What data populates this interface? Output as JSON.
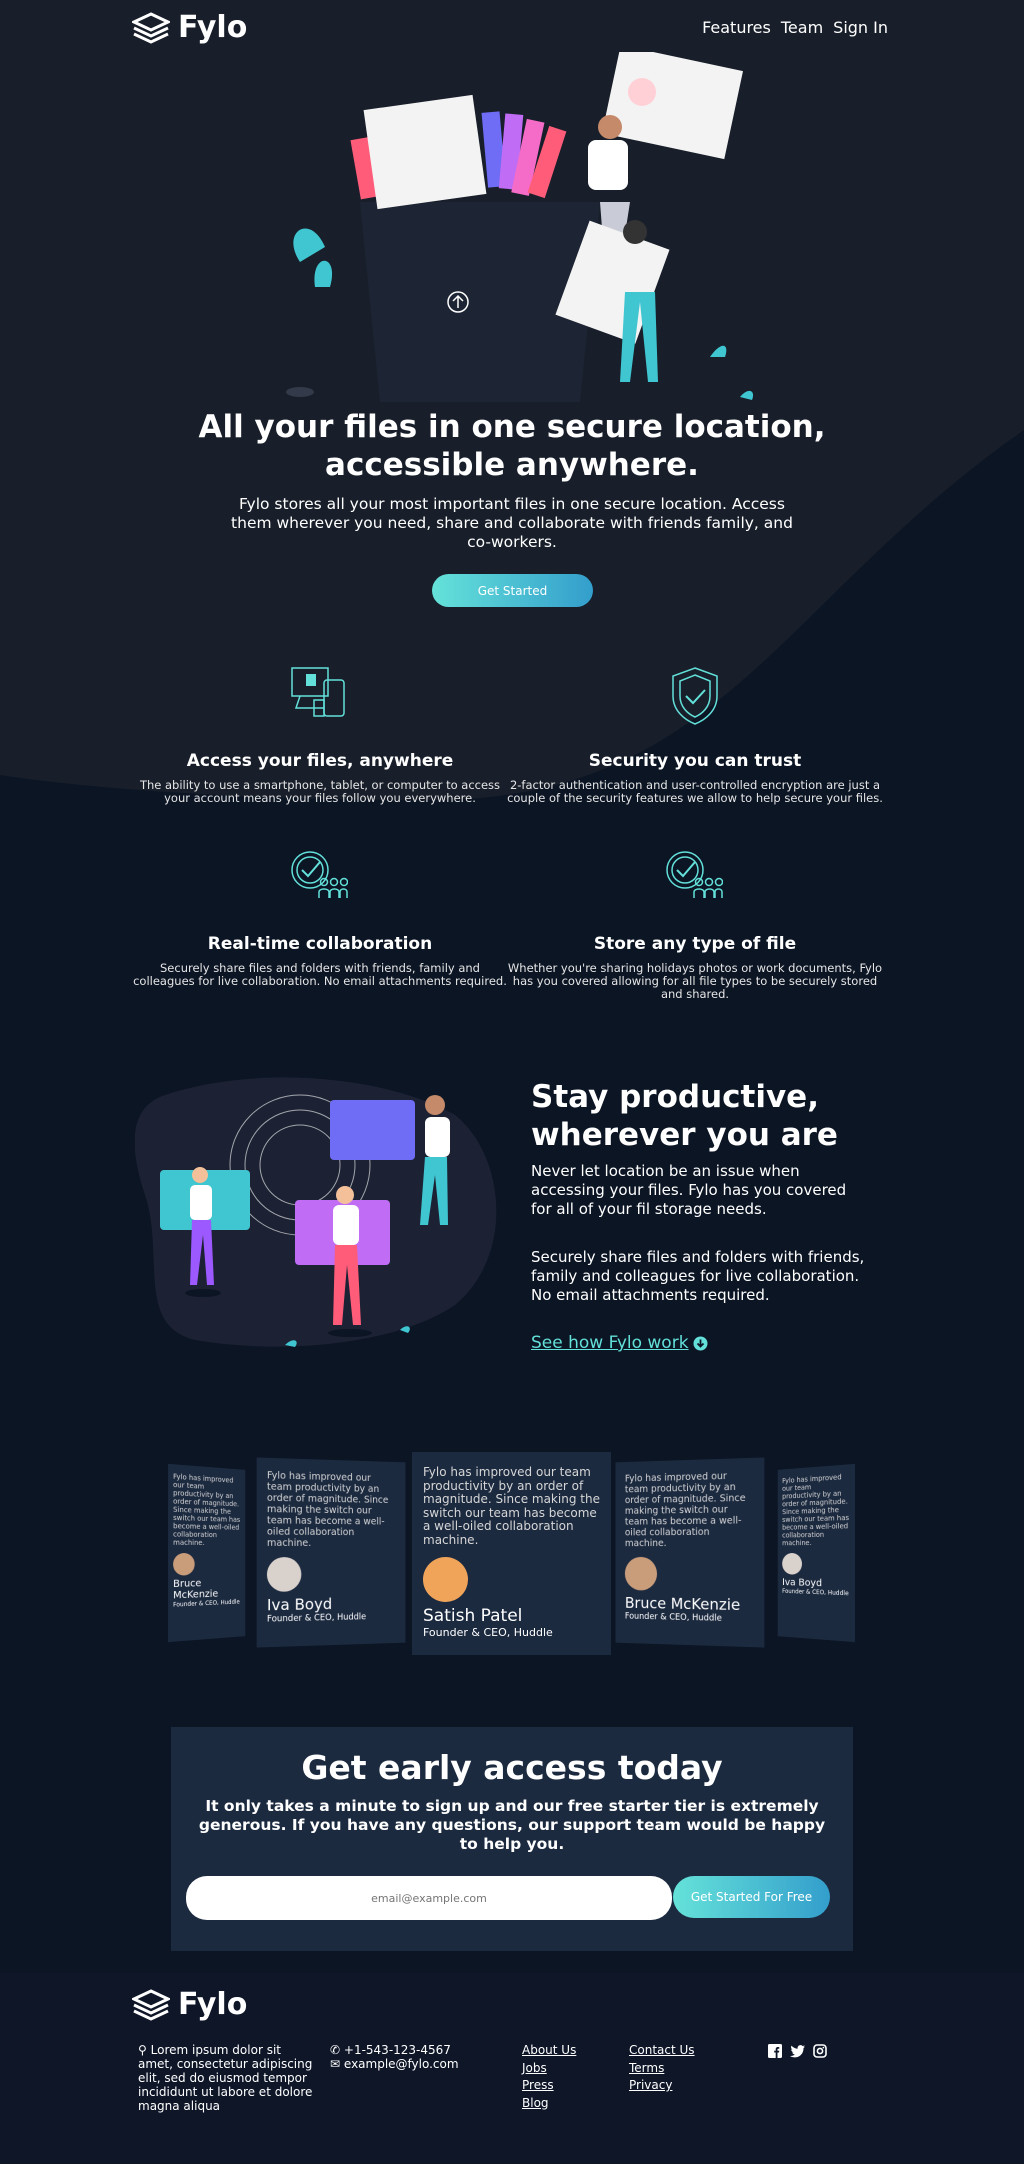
{
  "header": {
    "logo_text": "Fylo",
    "nav": [
      "Features",
      "Team",
      "Sign In"
    ]
  },
  "hero": {
    "title": "All your files in one secure location, accessible anywhere.",
    "text": "Fylo stores all your most important files in one secure location. Access them wherever you need, share and collaborate with friends family, and co-workers.",
    "cta": "Get Started"
  },
  "features": [
    {
      "icon": "devices-icon",
      "title": "Access your files, anywhere",
      "text": "The ability to use a smartphone, tablet, or computer to access your account means your files follow you everywhere."
    },
    {
      "icon": "shield-check-icon",
      "title": "Security you can trust",
      "text": "2-factor authentication and user-controlled encryption are just a couple of the security features we allow to help secure your files."
    },
    {
      "icon": "collaboration-icon",
      "title": "Real-time collaboration",
      "text": "Securely share files and folders with friends, family and colleagues for live collaboration. No email attachments required."
    },
    {
      "icon": "collaboration-icon",
      "title": "Store any type of file",
      "text": "Whether you're sharing holidays photos or work documents, Fylo has you covered allowing for all file types to be securely stored and shared."
    }
  ],
  "productive": {
    "title": "Stay productive, wherever you are",
    "p1": "Never let location be an issue when accessing your files. Fylo has you covered for all of your fil storage needs.",
    "p2": "Securely share files and folders with friends, family and colleagues for live collaboration. No email attachments required.",
    "link": "See how Fylo work"
  },
  "testimonials": [
    {
      "quote": "Fylo has improved our team productivity by an order of magnitude. Since making the switch our team has become a well-oiled collaboration machine.",
      "name": "Bruce McKenzie",
      "role": "Founder & CEO, Huddle"
    },
    {
      "quote": "Fylo has improved our team productivity by an order of magnitude. Since making the switch our team has become a well-oiled collaboration machine.",
      "name": "Iva Boyd",
      "role": "Founder & CEO, Huddle"
    },
    {
      "quote": "Fylo has improved our team productivity by an order of magnitude. Since making the switch our team has become a well-oiled collaboration machine.",
      "name": "Satish Patel",
      "role": "Founder & CEO, Huddle"
    },
    {
      "quote": "Fylo has improved our team productivity by an order of magnitude. Since making the switch our team has become a well-oiled collaboration machine.",
      "name": "Bruce McKenzie",
      "role": "Founder & CEO, Huddle"
    },
    {
      "quote": "Fylo has improved our team productivity by an order of magnitude. Since making the switch our team has become a well-oiled collaboration machine.",
      "name": "Iva Boyd",
      "role": "Founder & CEO, Huddle"
    }
  ],
  "cta": {
    "title": "Get early access today",
    "text": "It only takes a minute to sign up and our free starter tier is extremely generous. If you have any questions, our support team would be happy to help you.",
    "email_placeholder": "email@example.com",
    "button": "Get Started For Free"
  },
  "footer": {
    "logo_text": "Fylo",
    "address": "Lorem ipsum dolor sit amet, consectetur adipiscing elit, sed do eiusmod tempor incididunt ut labore et dolore magna aliqua",
    "phone": "+1-543-123-4567",
    "email": "example@fylo.com",
    "links1": [
      "About Us",
      "Jobs",
      "Press",
      "Blog"
    ],
    "links2": [
      "Contact Us",
      "Terms",
      "Privacy"
    ],
    "social": [
      "facebook-icon",
      "twitter-icon",
      "instagram-icon"
    ]
  },
  "colors": {
    "bg_top": "#181f2a",
    "bg_dark": "#0c1524",
    "card": "#1c2a40",
    "accent": "#62e0d9",
    "accent2": "#339ecc"
  }
}
